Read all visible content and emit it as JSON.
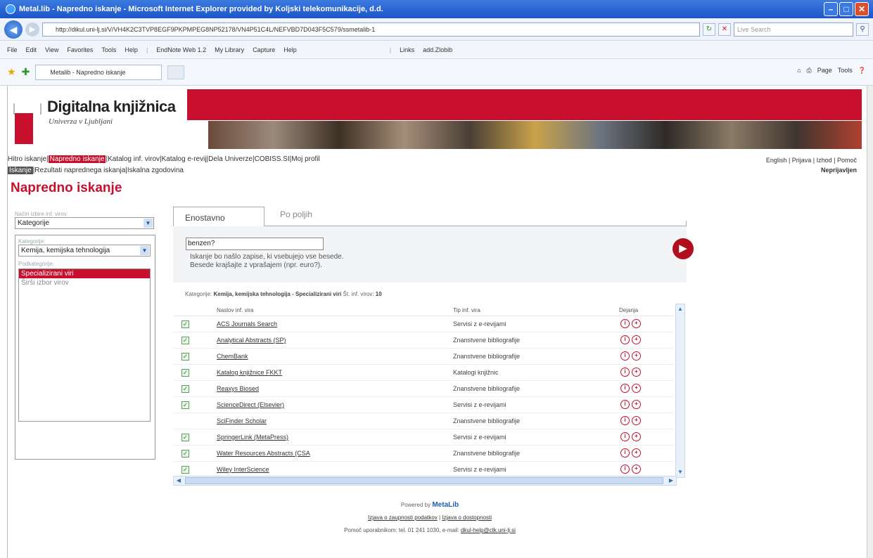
{
  "window": {
    "title": "Metal.lib - Napredno iskanje - Microsoft Internet Explorer provided by Koljski telekomunikacije, d.d."
  },
  "browser": {
    "url": "http://dikul.uni-lj.si/V/VH4K2C3TVP8EGF9PKPMPEG8NP52178/VN4P51C4L/NEFVBD7D043F5C579/ssmetalib-1",
    "search_placeholder": "Live Search",
    "menu": [
      "File",
      "Edit",
      "View",
      "Favorites",
      "Tools",
      "Help"
    ],
    "toolbar_links": [
      "EndNote Web 1.2",
      "My Library",
      "Capture",
      "Help"
    ],
    "links_label": "Links",
    "links_item": "add.Zlobib",
    "tab_title": "Metalib - Napredno iskanje",
    "tools": [
      "Page",
      "Tools"
    ]
  },
  "site": {
    "logo_title": "Digitalna knjižnica",
    "logo_subtitle": "Univerza v Ljubljani",
    "nav_line1": [
      {
        "label": "Hitro iskanje",
        "active": false
      },
      {
        "label": "Napredno iskanje",
        "active": true
      },
      {
        "label": "Katalog inf. virov",
        "active": false
      },
      {
        "label": "Katalog e-revij",
        "active": false
      },
      {
        "label": "Dela Univerze",
        "active": false
      },
      {
        "label": "COBISS.SI",
        "active": false
      },
      {
        "label": "Moj profil",
        "active": false
      }
    ],
    "nav_line2": [
      {
        "label": "Iskanje",
        "active": true
      },
      {
        "label": "Rezultati naprednega iskanja",
        "active": false
      },
      {
        "label": "Iskalna zgodovina",
        "active": false
      }
    ],
    "lang_links": "English | Prijava | Izhod | Pomoč",
    "user_status": "Neprijavljen"
  },
  "page": {
    "title": "Napredno iskanje"
  },
  "left_panel": {
    "mode_label": "Način izbire inf. virov:",
    "mode_value": "Kategorije",
    "category_label": "Kategorije:",
    "category_value": "Kemija, kemijska tehnologija",
    "subcategory_label": "Podkategorije:",
    "subcategory_selected": "Specializirani viri",
    "subcategory_other": "Širši izbor virov"
  },
  "search": {
    "tab_simple": "Enostavno",
    "tab_fields": "Po poljih",
    "query": "benzen?",
    "hint_line1": "Iskanje bo našlo zapise, ki vsebujejo vse besede.",
    "hint_line2": "Besede krajšajte z vprašajem (npr. euro?).",
    "category_line_prefix": "Kategorije: ",
    "category_line_bold": "Kemija, kemijska tehnologija - Specializirani viri",
    "category_line_mid": "  Št. inf. virov: ",
    "category_line_count": "10"
  },
  "table": {
    "col_name": "Naslov inf. vira",
    "col_type": "Tip inf. vira",
    "col_actions": "Dejanja",
    "rows": [
      {
        "name": "ACS Journals Search",
        "type": "Servisi z e-revijami",
        "checked": true
      },
      {
        "name": "Analytical Abstracts (SP)",
        "type": "Znanstvene bibliografije",
        "checked": true
      },
      {
        "name": "ChemBank",
        "type": "Znanstvene bibliografije",
        "checked": true
      },
      {
        "name": "Katalog knjižnice FKKT",
        "type": "Katalogi knjižnic",
        "checked": true
      },
      {
        "name": "Reaxys Biosed",
        "type": "Znanstvene bibliografije",
        "checked": true
      },
      {
        "name": "ScienceDirect (Elsevier)",
        "type": "Servisi z e-revijami",
        "checked": true
      },
      {
        "name": "SciFinder Scholar",
        "type": "Znanstvene bibliografije",
        "checked": false
      },
      {
        "name": "SpringerLink (MetaPress)",
        "type": "Servisi z e-revijami",
        "checked": true
      },
      {
        "name": "Water Resources Abstracts (CSA",
        "type": "Znanstvene bibliografije",
        "checked": true
      },
      {
        "name": "Wiley InterScience",
        "type": "Servisi z e-revijami",
        "checked": true
      }
    ],
    "icon_info": "i",
    "icon_add": "+"
  },
  "footer": {
    "powered_by": "Powered by",
    "brand": "MetaLib",
    "link1": "Izjava o zaupnosti podatkov",
    "link2": "Izjava o dostopnosti",
    "help_text": "Pomoč uporabnikom: tel. 01 241 1030, e-mail: ",
    "help_email": "dkul-help@ctk.uni-lj.si"
  }
}
